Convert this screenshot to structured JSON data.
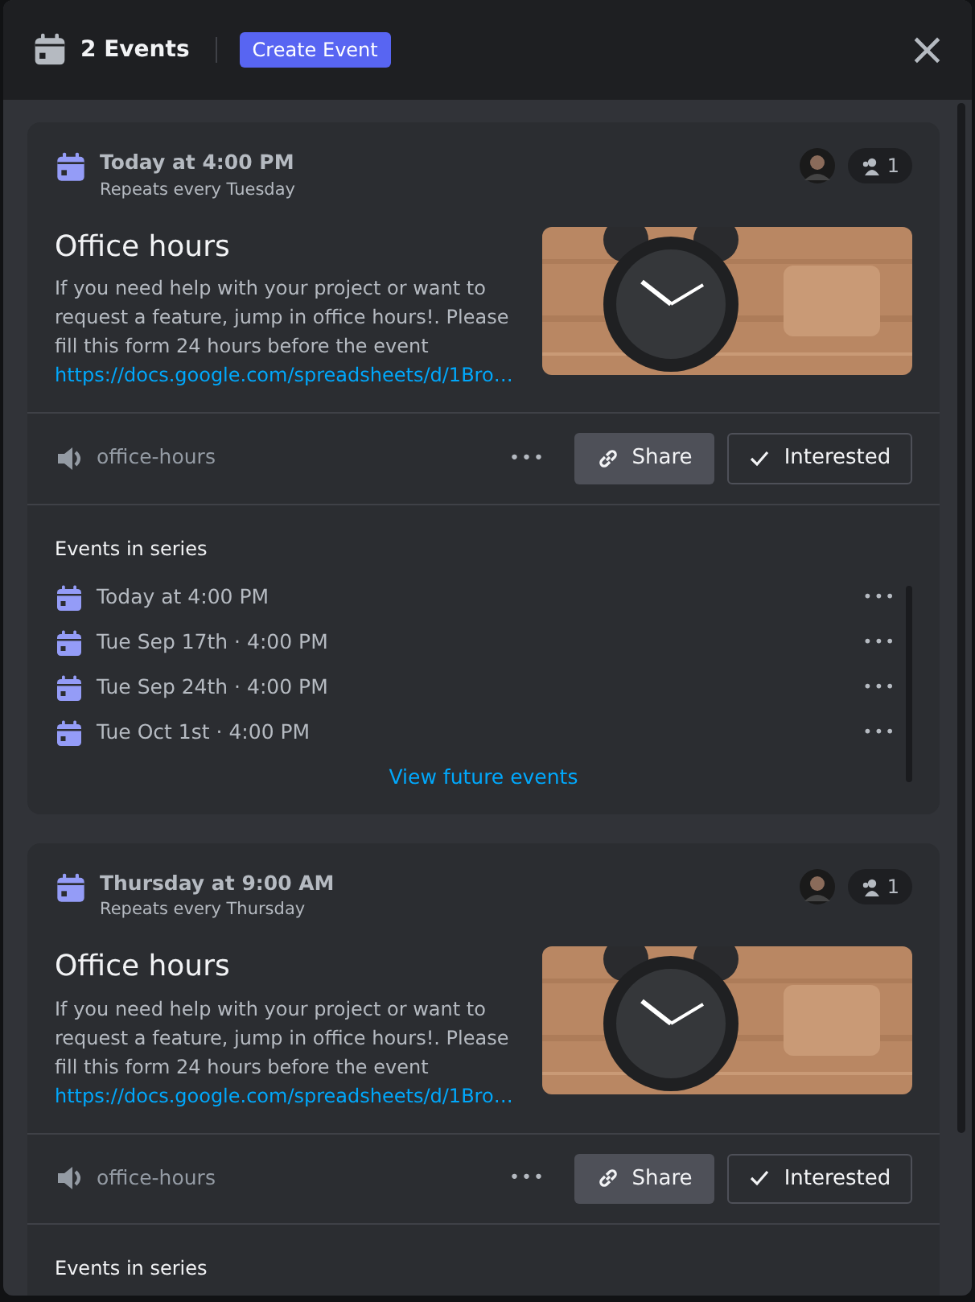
{
  "header": {
    "title": "2 Events",
    "create_button": "Create Event",
    "close": "×"
  },
  "events": [
    {
      "when": "Today at 4:00 PM",
      "repeat": "Repeats every Tuesday",
      "interested_count": "1",
      "title": "Office hours",
      "description": "If you need help with your project or want to request a feature, jump in office hours!. Please fill this form 24 hours before the event",
      "link": "https://docs.google.com/spreadsheets/d/1Bro…",
      "channel": "office-hours",
      "more": "•••",
      "share": "Share",
      "interested": "Interested",
      "series": {
        "heading": "Events in series",
        "items": [
          {
            "label": "Today at 4:00 PM",
            "more": "•••"
          },
          {
            "label": "Tue Sep 17th · 4:00 PM",
            "more": "•••"
          },
          {
            "label": "Tue Sep 24th · 4:00 PM",
            "more": "•••"
          },
          {
            "label": "Tue Oct 1st · 4:00 PM",
            "more": "•••"
          }
        ],
        "view_more": "View future events"
      }
    },
    {
      "when": "Thursday at 9:00 AM",
      "repeat": "Repeats every Thursday",
      "interested_count": "1",
      "title": "Office hours",
      "description": "If you need help with your project or want to request a feature, jump in office hours!. Please fill this form 24 hours before the event",
      "link": "https://docs.google.com/spreadsheets/d/1Bro…",
      "channel": "office-hours",
      "more": "•••",
      "share": "Share",
      "interested": "Interested",
      "series": {
        "heading": "Events in series"
      }
    }
  ]
}
